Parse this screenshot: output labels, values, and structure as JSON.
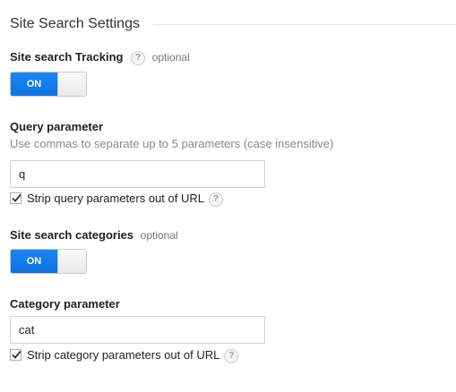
{
  "section": {
    "title": "Site Search Settings"
  },
  "site_search_tracking": {
    "label": "Site search Tracking",
    "help": "?",
    "optional": "optional",
    "toggle_label": "ON",
    "toggle_state": "on"
  },
  "query_parameter": {
    "label": "Query parameter",
    "description": "Use commas to separate up to 5 parameters (case insensitive)",
    "value": "q",
    "strip_label": "Strip query parameters out of URL",
    "strip_checked": true,
    "help": "?"
  },
  "site_search_categories": {
    "label": "Site search categories",
    "optional": "optional",
    "toggle_label": "ON",
    "toggle_state": "on"
  },
  "category_parameter": {
    "label": "Category parameter",
    "value": "cat",
    "strip_label": "Strip category parameters out of URL",
    "strip_checked": true,
    "help": "?"
  },
  "colors": {
    "toggle_on": "#1a85f5",
    "optional_text": "#777777",
    "description_text": "#888888"
  },
  "icons": {
    "help": "question-mark-circle-icon",
    "checkbox": "checkmark-icon"
  }
}
